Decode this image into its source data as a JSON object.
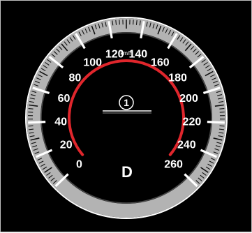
{
  "gauge": {
    "unit": "km/h",
    "labels": [
      "0",
      "20",
      "40",
      "60",
      "80",
      "100",
      "120",
      "140",
      "160",
      "180",
      "200",
      "220",
      "240",
      "260"
    ],
    "gear": "D",
    "marker": "1",
    "colors": {
      "background": "#000000",
      "bezel": "#b3b3b3",
      "ticks": "#ffffff",
      "red_arc": "#e0262c"
    }
  }
}
